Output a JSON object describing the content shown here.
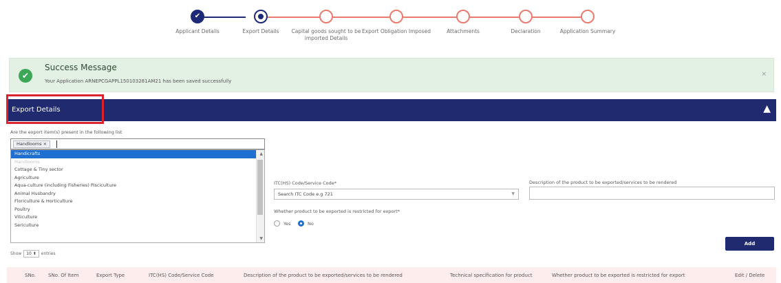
{
  "stepper": {
    "steps": [
      {
        "label": "Applicant Details"
      },
      {
        "label": "Export Details"
      },
      {
        "label": "Capital goods sought to be imported Details"
      },
      {
        "label": "Export Obligation Imposed"
      },
      {
        "label": "Attachments"
      },
      {
        "label": "Declaration"
      },
      {
        "label": "Application Summary"
      }
    ],
    "done_glyph": "✔"
  },
  "success": {
    "title": "Success Message",
    "message": "Your Application ARNEPCGAPPL150103281AM21 has been saved successfully",
    "close": "×",
    "tick": "✔"
  },
  "panel": {
    "title": "Export Details",
    "collapse_icon": "▲"
  },
  "form": {
    "question": "Are the export item(s) present in the following list",
    "tag": "Handlooms ×",
    "options": [
      "Handicrafts",
      "Handlooms",
      "Cottage & Tiny sector",
      "Agriculture",
      "Aqua-culture (including Fisheries) Pisciculture",
      "Animal Husbandry",
      "Floriculture & Horticulture",
      "Poultry",
      "Viticulture",
      "Sericulture"
    ],
    "itc_label": "ITC(HS) Code/Service Code*",
    "itc_placeholder": "Search ITC Code e.g 721",
    "desc_label": "Description of the product to be exported/services to be rendered",
    "restricted_label": "Whether product to be exported is restricted for export*",
    "radio_yes": "Yes",
    "radio_no": "No",
    "add": "Add"
  },
  "table": {
    "show": "Show",
    "page_size": "10 ⬍",
    "entries": "entries",
    "headers": [
      "SNo.",
      "SNo. Of Item",
      "Export Type",
      "ITC(HS) Code/Service Code",
      "Description of the product to be exported/services to be rendered",
      "Technical specification for product",
      "Whether product to be exported is restricted for export",
      "Edit / Delete"
    ]
  },
  "colors": {
    "primary": "#1f2a6f",
    "success_bg": "#e3f1e4",
    "highlight_red": "#d9232e",
    "stepper_pending": "#e87b6e"
  }
}
